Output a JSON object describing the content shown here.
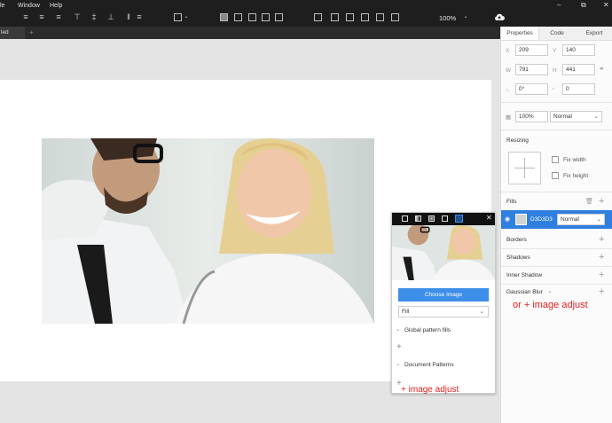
{
  "menu": {
    "items": [
      "le",
      "Window",
      "Help"
    ]
  },
  "toolbar": {
    "zoom": "100%"
  },
  "tabs": {
    "doc": "led",
    "add": "+"
  },
  "panel": {
    "tabs": [
      "Properties",
      "Code",
      "Export"
    ],
    "x_label": "X",
    "x": "209",
    "y_label": "Y",
    "y": "140",
    "w_label": "W",
    "w": "791",
    "h_label": "H",
    "h": "441",
    "rotation": "0°",
    "radius": "0",
    "opacity": "100%",
    "blend": "Normal",
    "resizing": "Resizing",
    "fix_width": "Fix width",
    "fix_height": "Fix height",
    "fills": "Fills",
    "fill_hex": "D3D3D3",
    "fill_blend": "Normal",
    "borders": "Borders",
    "shadows": "Shadows",
    "inner_shadow": "Inner Shadow",
    "gaussian_blur": "Gaussian Blur"
  },
  "popup": {
    "choose": "Choose Image",
    "fill": "Fill",
    "global": "Global pattern fills",
    "document": "Document Patterns"
  },
  "annotations": {
    "panel": "or + image adjust",
    "popup": "+ image adjust"
  },
  "colors": {
    "accent": "#2f7fe0",
    "annotation": "#e02020"
  }
}
